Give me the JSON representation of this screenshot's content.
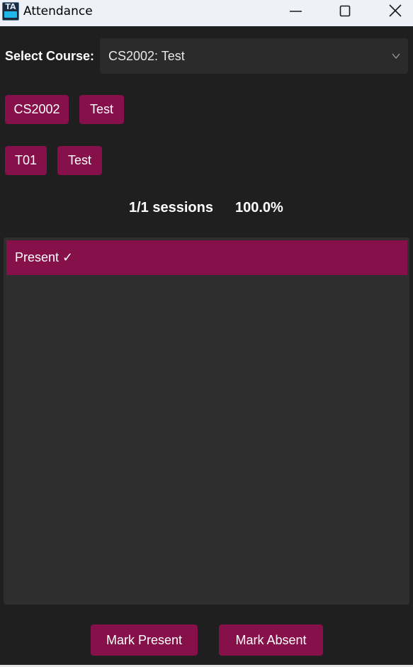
{
  "window": {
    "title": "Attendance",
    "icon": "ta-hub-app-icon",
    "icon_text": "TA",
    "controls": [
      "minimize-icon",
      "maximize-icon",
      "close-icon"
    ]
  },
  "course": {
    "label": "Select Course:",
    "selected": "CS2002: Test"
  },
  "course_chips": [
    "CS2002",
    "Test"
  ],
  "section_chips": [
    "T01",
    "Test"
  ],
  "stats": {
    "sessions": "1/1 sessions",
    "percent": "100.0%"
  },
  "records": [
    {
      "status": "Present ✓"
    }
  ],
  "actions": {
    "mark_present": "Mark Present",
    "mark_absent": "Mark Absent"
  },
  "colors": {
    "accent": "#86104a",
    "background": "#1f1f1f",
    "panel": "#2e2e2e",
    "titlebar": "#eef1f8"
  }
}
